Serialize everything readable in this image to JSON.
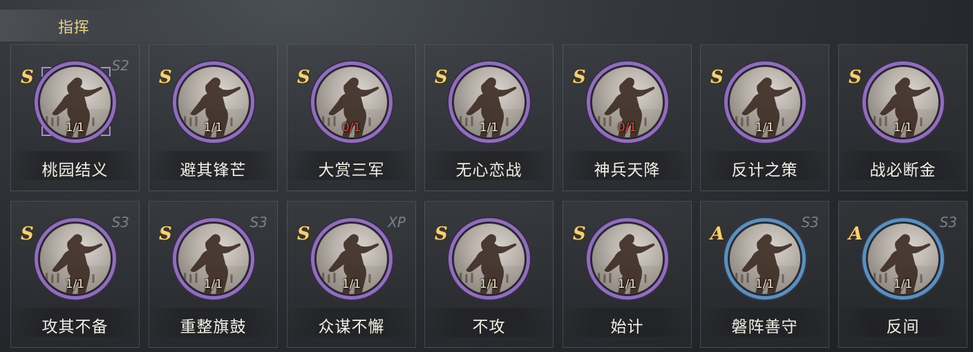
{
  "header": {
    "title": "指挥"
  },
  "colors": {
    "purple_ring": "#8f6fb6",
    "blue_ring": "#5f8fb8",
    "gold_text": "#e8cf8a",
    "zero_uses": "#e0473b"
  },
  "tactics": [
    {
      "name": "桃园结义",
      "grade": "S",
      "uses": "1/1",
      "tag": "S2",
      "ring": "purple",
      "selected": true
    },
    {
      "name": "避其锋芒",
      "grade": "S",
      "uses": "1/1",
      "tag": "",
      "ring": "purple"
    },
    {
      "name": "大赏三军",
      "grade": "S",
      "uses": "0/1",
      "tag": "",
      "ring": "purple"
    },
    {
      "name": "无心恋战",
      "grade": "S",
      "uses": "1/1",
      "tag": "",
      "ring": "purple"
    },
    {
      "name": "神兵天降",
      "grade": "S",
      "uses": "0/1",
      "tag": "",
      "ring": "purple"
    },
    {
      "name": "反计之策",
      "grade": "S",
      "uses": "1/1",
      "tag": "",
      "ring": "purple"
    },
    {
      "name": "战必断金",
      "grade": "S",
      "uses": "1/1",
      "tag": "",
      "ring": "purple"
    },
    {
      "name": "攻其不备",
      "grade": "S",
      "uses": "1/1",
      "tag": "S3",
      "ring": "purple"
    },
    {
      "name": "重整旗鼓",
      "grade": "S",
      "uses": "1/1",
      "tag": "S3",
      "ring": "purple"
    },
    {
      "name": "众谋不懈",
      "grade": "S",
      "uses": "1/1",
      "tag": "XP",
      "ring": "purple"
    },
    {
      "name": "不攻",
      "grade": "S",
      "uses": "1/1",
      "tag": "",
      "ring": "purple"
    },
    {
      "name": "始计",
      "grade": "S",
      "uses": "1/1",
      "tag": "",
      "ring": "purple"
    },
    {
      "name": "磐阵善守",
      "grade": "A",
      "uses": "1/1",
      "tag": "S3",
      "ring": "blue"
    },
    {
      "name": "反间",
      "grade": "A",
      "uses": "1/1",
      "tag": "S3",
      "ring": "blue"
    }
  ]
}
